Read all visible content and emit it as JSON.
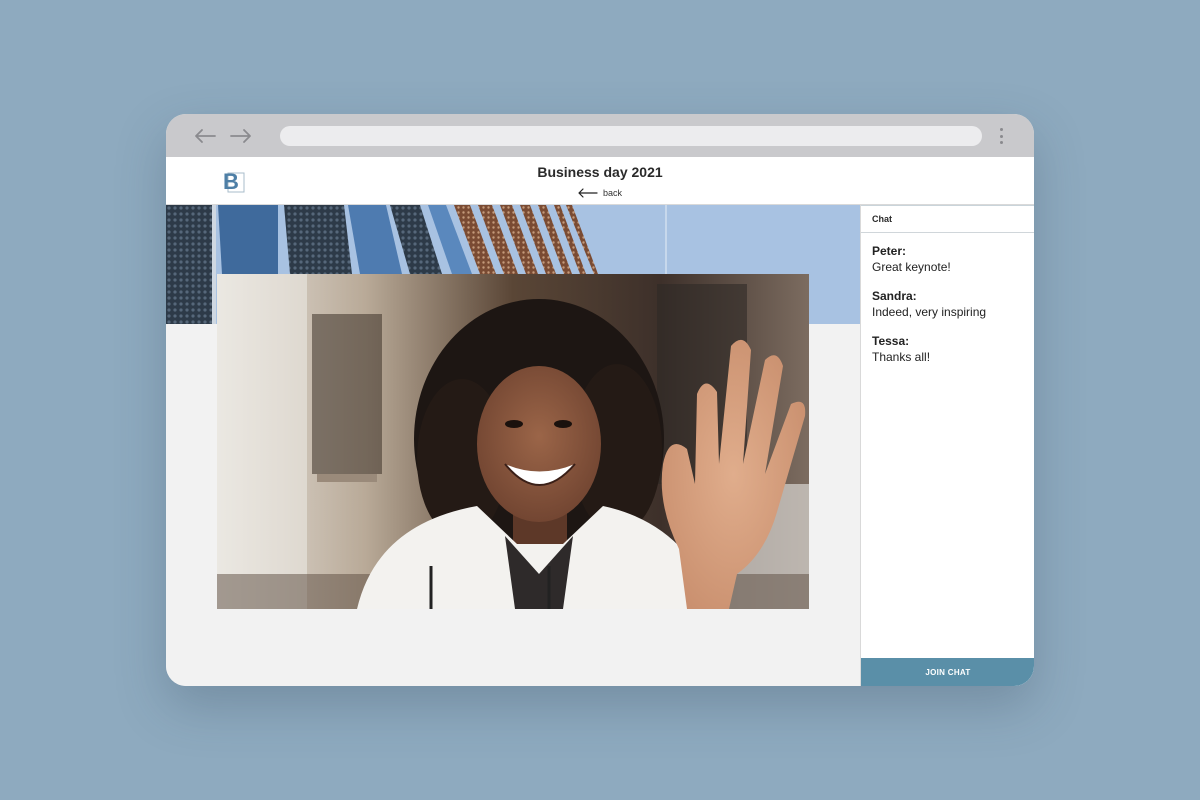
{
  "browser": {
    "back_icon": "arrow-left-icon",
    "forward_icon": "arrow-right-icon",
    "menu_icon": "more-vertical-icon"
  },
  "header": {
    "logo_letter": "B",
    "title": "Business day 2021",
    "back_label": "back",
    "back_icon": "arrow-left-icon"
  },
  "chat": {
    "title": "Chat",
    "messages": [
      {
        "author": "Peter:",
        "text": "Great keynote!"
      },
      {
        "author": "Sandra:",
        "text": "Indeed, very inspiring"
      },
      {
        "author": "Tessa:",
        "text": "Thanks all!"
      }
    ],
    "join_label": "JOIN CHAT"
  },
  "colors": {
    "background": "#8eaabf",
    "accent": "#5a8fa8",
    "logo": "#4e7fa6"
  }
}
